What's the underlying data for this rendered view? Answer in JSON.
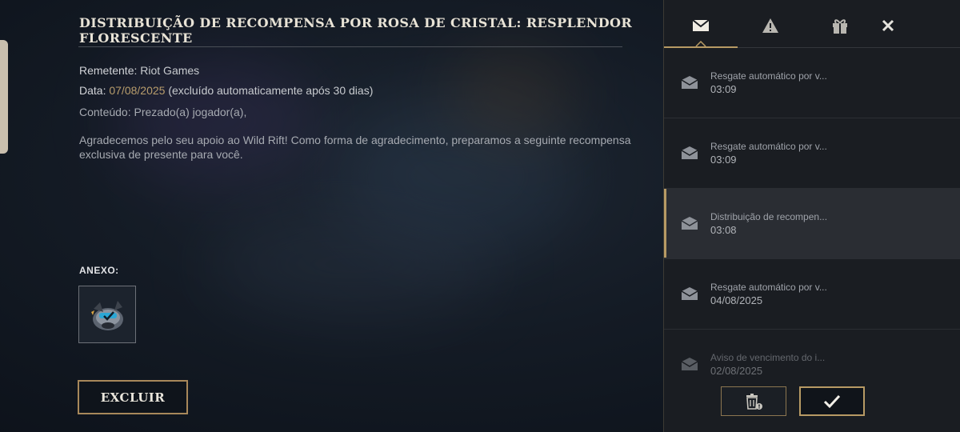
{
  "mail": {
    "title": "DISTRIBUIÇÃO DE RECOMPENSA POR ROSA DE CRISTAL: RESPLENDOR FLORESCENTE",
    "sender_label": "Remetente:",
    "sender_value": "Riot Games",
    "date_label": "Data:",
    "date_value": "07/08/2025",
    "date_note": "(excluído automaticamente após 30 dias)",
    "content_line": "Conteúdo: Prezado(a) jogador(a),",
    "body": "Agradecemos pelo seu apoio ao Wild Rift! Como forma de agradecimento, preparamos a seguinte recompensa exclusiva de presente para você.",
    "attachment_label": "ANEXO:",
    "attachment_icon": "poro-icon",
    "delete_label": "EXCLUIR"
  },
  "panel": {
    "tabs": [
      {
        "name": "mail-tab",
        "icon": "mail-icon",
        "active": true
      },
      {
        "name": "alert-tab",
        "icon": "warning-icon",
        "active": false
      },
      {
        "name": "gift-tab",
        "icon": "gift-icon",
        "active": false
      }
    ],
    "close_icon": "close-icon",
    "items": [
      {
        "subject": "Resgate automático por v...",
        "time": "03:09",
        "active": false
      },
      {
        "subject": "Resgate automático por v...",
        "time": "03:09",
        "active": false
      },
      {
        "subject": "Distribuição de recompen...",
        "time": "03:08",
        "active": true
      },
      {
        "subject": "Resgate automático por v...",
        "time": "04/08/2025",
        "active": false
      },
      {
        "subject": "Aviso de vencimento do i...",
        "time": "02/08/2025",
        "active": false
      }
    ],
    "trash_icon": "trash-all-icon",
    "confirm_icon": "check-icon"
  },
  "colors": {
    "accent_gold": "#b79a64",
    "panel_bg": "#1a1d22",
    "active_item_bg": "#2a2d33"
  }
}
